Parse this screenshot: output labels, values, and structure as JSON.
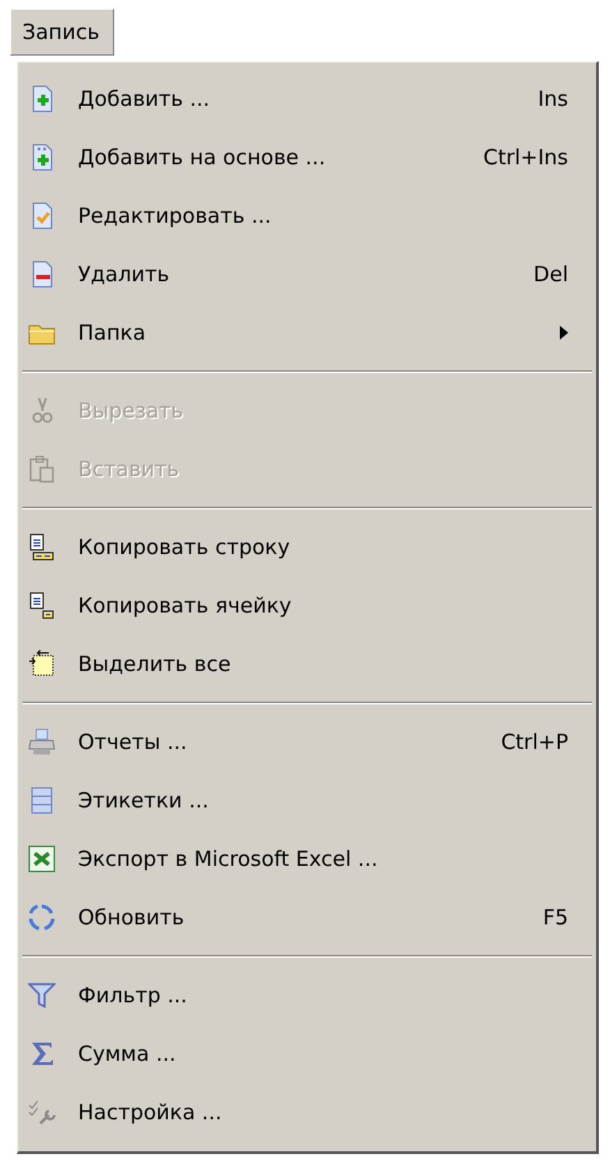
{
  "menu_title": "Запись",
  "groups": [
    {
      "items": [
        {
          "label": "Добавить ...",
          "shortcut": "Ins",
          "disabled": false,
          "submenu": false
        },
        {
          "label": "Добавить на основе ...",
          "shortcut": "Ctrl+Ins",
          "disabled": false,
          "submenu": false
        },
        {
          "label": "Редактировать ...",
          "disabled": false,
          "submenu": false
        },
        {
          "label": "Удалить",
          "shortcut": "Del",
          "disabled": false,
          "submenu": false
        },
        {
          "label": "Папка",
          "disabled": false,
          "submenu": true
        }
      ]
    },
    {
      "items": [
        {
          "label": "Вырезать",
          "disabled": true,
          "submenu": false
        },
        {
          "label": "Вставить",
          "disabled": true,
          "submenu": false
        }
      ]
    },
    {
      "items": [
        {
          "label": "Копировать строку",
          "disabled": false,
          "submenu": false
        },
        {
          "label": "Копировать ячейку",
          "disabled": false,
          "submenu": false
        },
        {
          "label": "Выделить все",
          "disabled": false,
          "submenu": false
        }
      ]
    },
    {
      "items": [
        {
          "label": "Отчеты ...",
          "shortcut": "Ctrl+P",
          "disabled": false,
          "submenu": false
        },
        {
          "label": "Этикетки ...",
          "disabled": false,
          "submenu": false
        },
        {
          "label": "Экспорт в Microsoft Excel ...",
          "disabled": false,
          "submenu": false
        },
        {
          "label": "Обновить",
          "shortcut": "F5",
          "disabled": false,
          "submenu": false
        }
      ]
    },
    {
      "items": [
        {
          "label": "Фильтр ...",
          "disabled": false,
          "submenu": false
        },
        {
          "label": "Сумма ...",
          "disabled": false,
          "submenu": false
        },
        {
          "label": "Настройка ...",
          "disabled": false,
          "submenu": false
        }
      ]
    }
  ]
}
